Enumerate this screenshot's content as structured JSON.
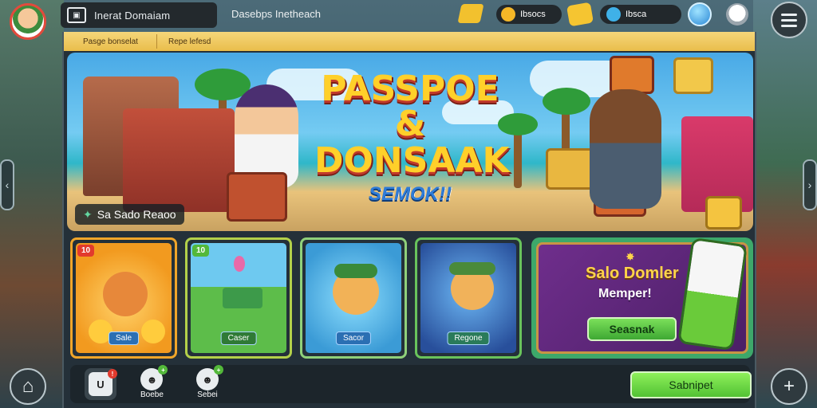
{
  "header": {
    "title": "Inerat Domaiam",
    "subtitle": "Dasebps Inetheach",
    "tickets": "Ibsocs",
    "gems": "Ibsca"
  },
  "tabs": [
    {
      "label": "Pasge bonselat"
    },
    {
      "label": "Repe lefesd"
    }
  ],
  "banner": {
    "logo_line1": "PASSPOE &",
    "logo_line2": "DONSAAK",
    "logo_line3": "SEMOK!!",
    "caption": "Sa Sado Reaoo"
  },
  "cards": [
    {
      "badge": "10",
      "label": "Sale"
    },
    {
      "badge": "10",
      "label": "Caser"
    },
    {
      "badge": "",
      "label": "Sacor"
    },
    {
      "badge": "",
      "label": "Regone"
    }
  ],
  "promo": {
    "title": "Salo Domler",
    "subtitle": "Memper!",
    "button": "Seasnak"
  },
  "bottom": {
    "item1_icon": "U",
    "item2_label": "Boebe",
    "item3_label": "Sebei",
    "cta": "Sabnipet"
  },
  "icons": {
    "home": "home-icon",
    "add": "plus-icon",
    "menu": "hamburger-icon"
  },
  "colors": {
    "accent_green": "#52c234",
    "tab_gold": "#e9bd4b",
    "badge_red": "#e23a2d"
  }
}
